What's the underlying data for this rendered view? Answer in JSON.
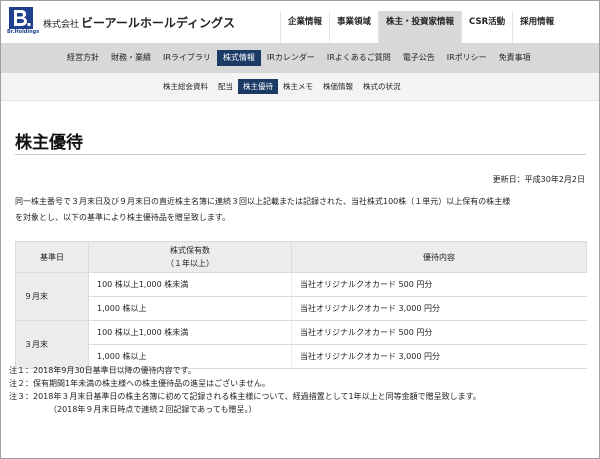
{
  "brand": {
    "logo_letter": "B",
    "logo_sub": "Br.Holdings",
    "company_prefix": "株式会社",
    "company_name": "ビーアールホールディングス",
    "color": "#1f3f8f"
  },
  "top_nav": {
    "items": [
      {
        "label": "企業情報",
        "active": false
      },
      {
        "label": "事業領域",
        "active": false
      },
      {
        "label": "株主・投資家情報",
        "active": true
      },
      {
        "label": "CSR活動",
        "active": false
      },
      {
        "label": "採用情報",
        "active": false
      }
    ]
  },
  "sub_nav": {
    "items": [
      {
        "label": "経営方針",
        "active": false
      },
      {
        "label": "財務・業績",
        "active": false
      },
      {
        "label": "IRライブラリ",
        "active": false
      },
      {
        "label": "株式情報",
        "active": true
      },
      {
        "label": "IRカレンダー",
        "active": false
      },
      {
        "label": "IRよくあるご質問",
        "active": false
      },
      {
        "label": "電子公告",
        "active": false
      },
      {
        "label": "IRポリシー",
        "active": false
      },
      {
        "label": "免責事項",
        "active": false
      }
    ]
  },
  "sub_nav2": {
    "items": [
      {
        "label": "株主総会資料",
        "active": false
      },
      {
        "label": "配当",
        "active": false
      },
      {
        "label": "株主優待",
        "active": true
      },
      {
        "label": "株主メモ",
        "active": false
      },
      {
        "label": "株価情報",
        "active": false
      },
      {
        "label": "株式の状況",
        "active": false
      }
    ]
  },
  "page": {
    "title": "株主優待",
    "updated": "更新日：平成30年2月2日",
    "intro_line1": "同一株主番号で３月末日及び９月末日の直近株主名簿に連続３回以上記載または記録された、当社株式100株（１単元）以上保有の株主様",
    "intro_line2": "を対象とし、以下の基準により株主優待品を贈呈致します。"
  },
  "table": {
    "headers": {
      "record_date": "基準日",
      "shares_line1": "株式保有数",
      "shares_line2": "（１年以上）",
      "benefit": "優待内容"
    },
    "groups": [
      {
        "month": "９月末",
        "rows": [
          {
            "shares": "100 株以上1,000 株未満",
            "benefit": "当社オリジナルクオカード 500 円分"
          },
          {
            "shares": "1,000 株以上",
            "benefit": "当社オリジナルクオカード 3,000 円分"
          }
        ]
      },
      {
        "month": "３月末",
        "rows": [
          {
            "shares": "100 株以上1,000 株未満",
            "benefit": "当社オリジナルクオカード 500 円分"
          },
          {
            "shares": "1,000 株以上",
            "benefit": "当社オリジナルクオカード 3,000 円分"
          }
        ]
      }
    ]
  },
  "notes": [
    "注１：2018年9月30日基準日以降の優待内容です。",
    "注２：保有期間1年未満の株主様への株主優待品の進呈はございません。",
    "注３：2018年３月末日基準日の株主名簿に初めて記録される株主様について、経過措置として1年以上と同等金額で贈呈致します。",
    "（2018年９月末日時点で連続２回記録であっても贈呈。）"
  ]
}
